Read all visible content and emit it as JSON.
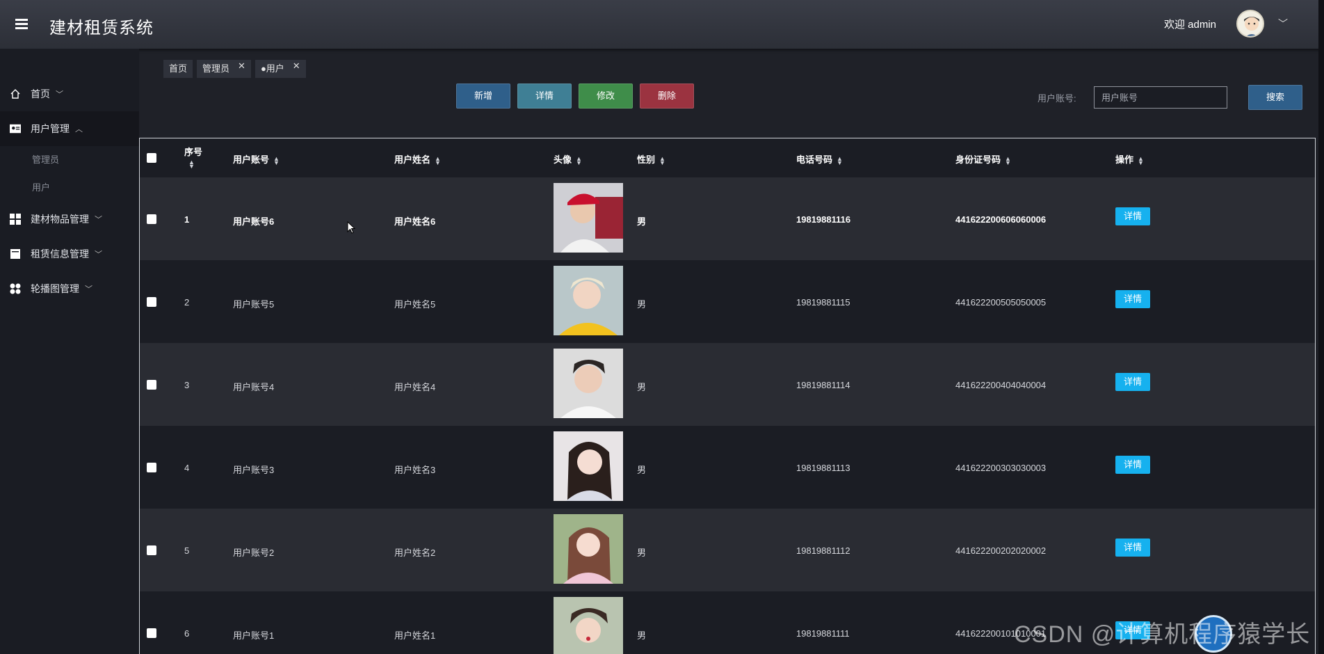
{
  "app": {
    "title": "建材租赁系统",
    "welcome": "欢迎 admin"
  },
  "sidebar": {
    "items": [
      {
        "label": "首页",
        "icon": "home-icon",
        "arrow": "﹀"
      },
      {
        "label": "用户管理",
        "icon": "user-card-icon",
        "arrow": "︿"
      },
      {
        "label": "建材物品管理",
        "icon": "grid-icon",
        "arrow": "﹀"
      },
      {
        "label": "租赁信息管理",
        "icon": "document-icon",
        "arrow": "﹀"
      },
      {
        "label": "轮播图管理",
        "icon": "apps-icon",
        "arrow": "﹀"
      }
    ],
    "subitems": [
      "管理员",
      "用户"
    ]
  },
  "tags": [
    {
      "label": "首页"
    },
    {
      "label": "管理员",
      "close": "✕"
    },
    {
      "label": "●用户",
      "close": "✕"
    }
  ],
  "toolbar": {
    "add_label": "新增",
    "detail_label": "详情",
    "edit_label": "修改",
    "delete_label": "删除",
    "search_label": "用户账号:",
    "search_placeholder": "用户账号",
    "search_button": "搜索"
  },
  "table": {
    "headers": [
      "序号",
      "用户账号",
      "用户姓名",
      "头像",
      "性别",
      "电话号码",
      "身份证号码",
      "操作"
    ],
    "detail_label": "详情",
    "rows": [
      {
        "no": "1",
        "account": "用户账号6",
        "name": "用户姓名6",
        "gender": "男",
        "phone": "19819881116",
        "id_card": "441622200606060006"
      },
      {
        "no": "2",
        "account": "用户账号5",
        "name": "用户姓名5",
        "gender": "男",
        "phone": "19819881115",
        "id_card": "441622200505050005"
      },
      {
        "no": "3",
        "account": "用户账号4",
        "name": "用户姓名4",
        "gender": "男",
        "phone": "19819881114",
        "id_card": "441622200404040004"
      },
      {
        "no": "4",
        "account": "用户账号3",
        "name": "用户姓名3",
        "gender": "男",
        "phone": "19819881113",
        "id_card": "441622200303030003"
      },
      {
        "no": "5",
        "account": "用户账号2",
        "name": "用户姓名2",
        "gender": "男",
        "phone": "19819881112",
        "id_card": "441622200202020002"
      },
      {
        "no": "6",
        "account": "用户账号1",
        "name": "用户姓名1",
        "gender": "男",
        "phone": "19819881111",
        "id_card": "441622200101010001"
      }
    ]
  },
  "watermark": "CSDN @计算机程序猿学长",
  "colors": {
    "add": "#2f5f8a",
    "detail": "#3f7f95",
    "edit": "#3f8d4a",
    "delete": "#9b3340",
    "search": "#2f5f8a",
    "row_detail": "#16b1ef"
  }
}
